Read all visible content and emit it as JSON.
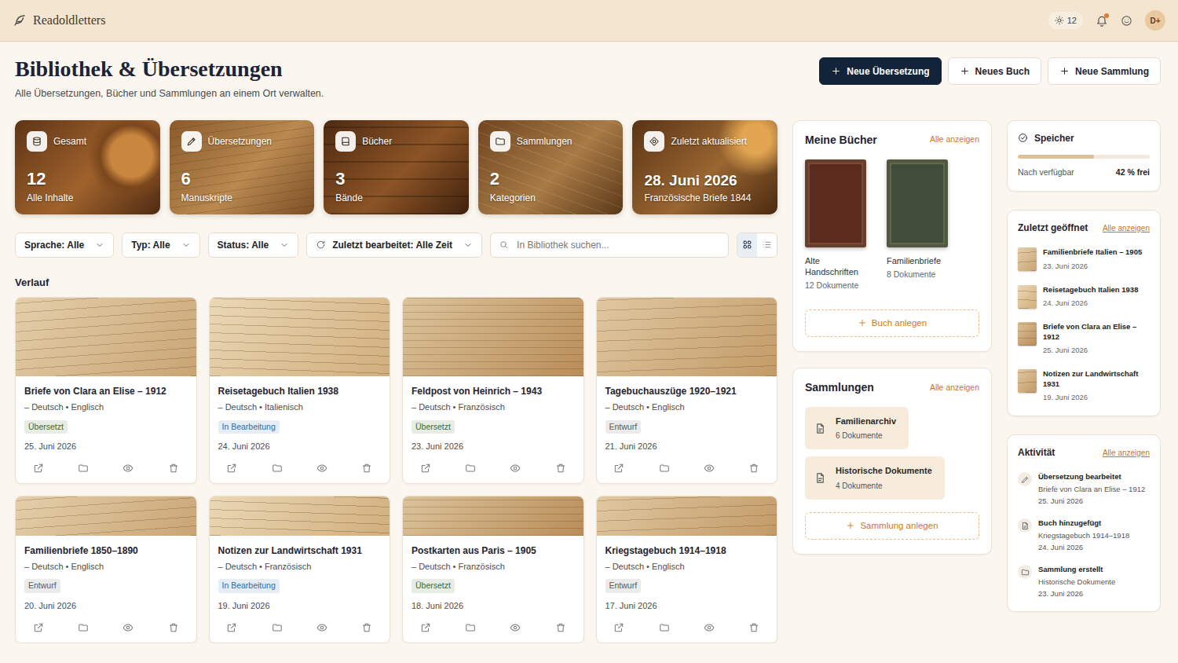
{
  "app": {
    "name": "Readoldletters"
  },
  "header": {
    "credits": "12",
    "unread": true,
    "avatar": "D+"
  },
  "page": {
    "title": "Bibliothek & Übersetzungen",
    "subtitle": "Alle Übersetzungen, Bücher und Sammlungen an einem Ort verwalten."
  },
  "actions": [
    {
      "label": "Neue Übersetzung",
      "kind": "primary"
    },
    {
      "label": "Neues Buch",
      "kind": "outline"
    },
    {
      "label": "Neue Sammlung",
      "kind": "outline"
    }
  ],
  "stats": [
    {
      "kind": "total",
      "label": "Gesamt",
      "value": "12",
      "caption": "Alle Inhalte"
    },
    {
      "kind": "translations",
      "label": "Übersetzungen",
      "value": "6",
      "caption": "Manuskripte"
    },
    {
      "kind": "books",
      "label": "Bücher",
      "value": "3",
      "caption": "Bände"
    },
    {
      "kind": "collections",
      "label": "Sammlungen",
      "value": "2",
      "caption": "Kategorien"
    },
    {
      "kind": "updated",
      "label": "Zuletzt aktualisiert",
      "value": "28. Juni 2026",
      "caption": "Französische Briefe 1844"
    }
  ],
  "filters": [
    {
      "label": "Sprache: Alle",
      "kind": "plain"
    },
    {
      "label": "Typ: Alle",
      "kind": "plain"
    },
    {
      "label": "Status: Alle",
      "kind": "plain"
    },
    {
      "label": "Zuletzt bearbeitet: Alle Zeit",
      "kind": "recent"
    }
  ],
  "search": {
    "placeholder": "In Bibliothek suchen..."
  },
  "view_modes": [
    {
      "kind": "grid",
      "selected": true
    },
    {
      "kind": "list",
      "selected": false
    }
  ],
  "history": {
    "title": "Verlauf",
    "items": [
      {
        "title": "Briefe von Clara an Elise – 1912",
        "languages": "– Deutsch • Englisch",
        "status": "Übersetzt",
        "color": "#3d6b2a",
        "date": "25. Juni 2026"
      },
      {
        "title": "Reisetagebuch Italien 1938",
        "languages": "– Deutsch • Italienisch",
        "status": "In Bearbeitung",
        "color": "#3469a8",
        "date": "24. Juni 2026"
      },
      {
        "title": "Feldpost von Heinrich – 1943",
        "languages": "– Deutsch • Französisch",
        "status": "Übersetzt",
        "color": "#3d6b2a",
        "date": "23. Juni 2026"
      },
      {
        "title": "Tagebuchauszüge 1920–1921",
        "languages": "– Deutsch • Englisch",
        "status": "Entwurf",
        "color": "#5a5a5a",
        "date": "21. Juni 2026"
      },
      {
        "title": "Familienbriefe 1850–1890",
        "languages": "– Deutsch • Englisch",
        "status": "Entwurf",
        "color": "#5a5a5a",
        "date": "20. Juni 2026"
      },
      {
        "title": "Notizen zur Landwirtschaft 1931",
        "languages": "– Deutsch • Französisch",
        "status": "In Bearbeitung",
        "color": "#3469a8",
        "date": "19. Juni 2026"
      },
      {
        "title": "Postkarten aus Paris – 1905",
        "languages": "– Deutsch • Französisch",
        "status": "Übersetzt",
        "color": "#3d6b2a",
        "date": "18. Juni 2026"
      },
      {
        "title": "Kriegstagebuch 1914–1918",
        "languages": "– Deutsch • Englisch",
        "status": "Entwurf",
        "color": "#5a5a5a",
        "date": "17. Juni 2026"
      }
    ]
  },
  "books": {
    "title": "Meine Bücher",
    "link": "Alle anzeigen",
    "add": "Buch anlegen",
    "items": [
      {
        "title": "Alte Handschriften",
        "count": "12 Dokumente",
        "color": "#5b2b1e"
      },
      {
        "title": "Familienbriefe",
        "count": "8 Dokumente",
        "color": "#3f4d3a"
      }
    ]
  },
  "collections": {
    "title": "Sammlungen",
    "link": "Alle anzeigen",
    "add": "Sammlung anlegen",
    "items": [
      {
        "title": "Familienarchiv",
        "count": "6 Dokumente"
      },
      {
        "title": "Historische Dokumente",
        "count": "4 Dokumente"
      }
    ]
  },
  "storage": {
    "title": "Speicher",
    "label": "Nach verfügbar",
    "reading": "42 % frei",
    "level": 0.58
  },
  "recent": {
    "title": "Zuletzt geöffnet",
    "link": "Alle anzeigen",
    "items": [
      {
        "title": "Familienbriefe Italien – 1905",
        "date": "23. Juni 2026"
      },
      {
        "title": "Reisetagebuch Italien 1938",
        "date": "24. Juni 2026"
      },
      {
        "title": "Briefe von Clara an Elise – 1912",
        "date": "25. Juni 2026"
      },
      {
        "title": "Notizen zur Landwirtschaft 1931",
        "date": "19. Juni 2026"
      }
    ]
  },
  "activity": {
    "title": "Aktivität",
    "link": "Alle anzeigen",
    "items": [
      {
        "kind": "edit",
        "title": "Übersetzung bearbeitet",
        "subject": "Briefe von Clara an Elise – 1912",
        "date": "25. Juni 2026"
      },
      {
        "kind": "book",
        "title": "Buch hinzugefügt",
        "subject": "Kriegstagebuch 1914–1918",
        "date": "24. Juni 2026"
      },
      {
        "kind": "folder",
        "title": "Sammlung erstellt",
        "subject": "Historische Dokumente",
        "date": "23. Juni 2026"
      }
    ]
  }
}
